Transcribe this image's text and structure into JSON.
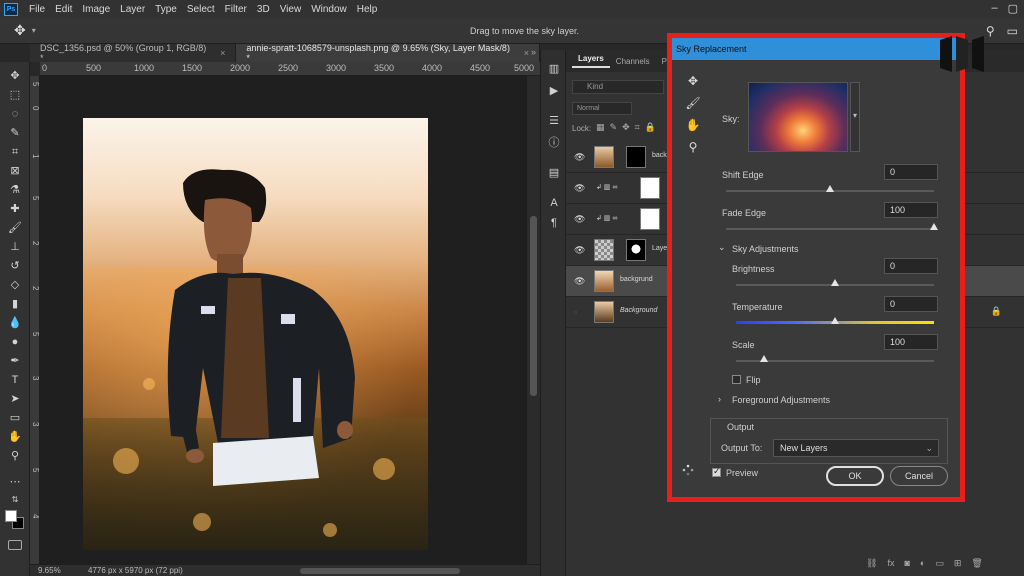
{
  "menubar": {
    "logo": "Ps",
    "items": [
      "File",
      "Edit",
      "Image",
      "Layer",
      "Type",
      "Select",
      "Filter",
      "3D",
      "View",
      "Window",
      "Help"
    ]
  },
  "options": {
    "hint": "Drag to move the sky layer."
  },
  "tabs": [
    {
      "label": "DSC_1356.psd @ 50% (Group 1, RGB/8) *",
      "close": "×"
    },
    {
      "label": "annie-spratt-1068579-unsplash.png @ 9.65% (Sky, Layer Mask/8) *",
      "close": "×"
    }
  ],
  "tabs_more": "»",
  "ruler_h": [
    "0",
    "500",
    "1000",
    "1500",
    "2000",
    "2500",
    "3000",
    "3500",
    "4000",
    "4500",
    "5000"
  ],
  "ruler_v": [
    "5",
    "0",
    "1",
    "5",
    "2",
    "2",
    "5",
    "3",
    "3",
    "5",
    "4"
  ],
  "status": {
    "zoom": "9.65%",
    "info": "4776 px x 5970 px (72 ppi)"
  },
  "layers_panel": {
    "tabs": [
      "Layers",
      "Channels",
      "Pa"
    ],
    "filter": "Kind",
    "blend": "Normal",
    "lock_label": "Lock:",
    "layers": [
      {
        "name": "back",
        "italic": false,
        "selected": false
      },
      {
        "name": "",
        "italic": false,
        "selected": false
      },
      {
        "name": "",
        "italic": false,
        "selected": false
      },
      {
        "name": "Laye",
        "italic": false,
        "selected": false
      },
      {
        "name": "backgrund",
        "italic": false,
        "selected": true
      },
      {
        "name": "Background",
        "italic": true,
        "selected": false
      }
    ]
  },
  "dialog": {
    "title": "Sky Replacement",
    "close": "×",
    "sky_label": "Sky:",
    "shift_edge": {
      "label": "Shift Edge",
      "value": "0",
      "fraction": 0.5
    },
    "fade_edge": {
      "label": "Fade Edge",
      "value": "100",
      "fraction": 1.0
    },
    "sky_adjustments": "Sky Adjustments",
    "brightness": {
      "label": "Brightness",
      "value": "0",
      "fraction": 0.5
    },
    "temperature": {
      "label": "Temperature",
      "value": "0",
      "fraction": 0.5
    },
    "scale": {
      "label": "Scale",
      "value": "100",
      "fraction": 0.14
    },
    "flip": {
      "label": "Flip",
      "checked": false
    },
    "foreground_adjustments": "Foreground Adjustments",
    "output_label": "Output",
    "output_to_label": "Output To:",
    "output_to_value": "New Layers",
    "preview": {
      "label": "Preview",
      "checked": true
    },
    "ok": "OK",
    "cancel": "Cancel"
  },
  "colors": {
    "title_bar": "#2f8fd8",
    "highlight": "#e8201c",
    "temp_cool": "#2b3cff",
    "temp_warm": "#ffe000"
  }
}
